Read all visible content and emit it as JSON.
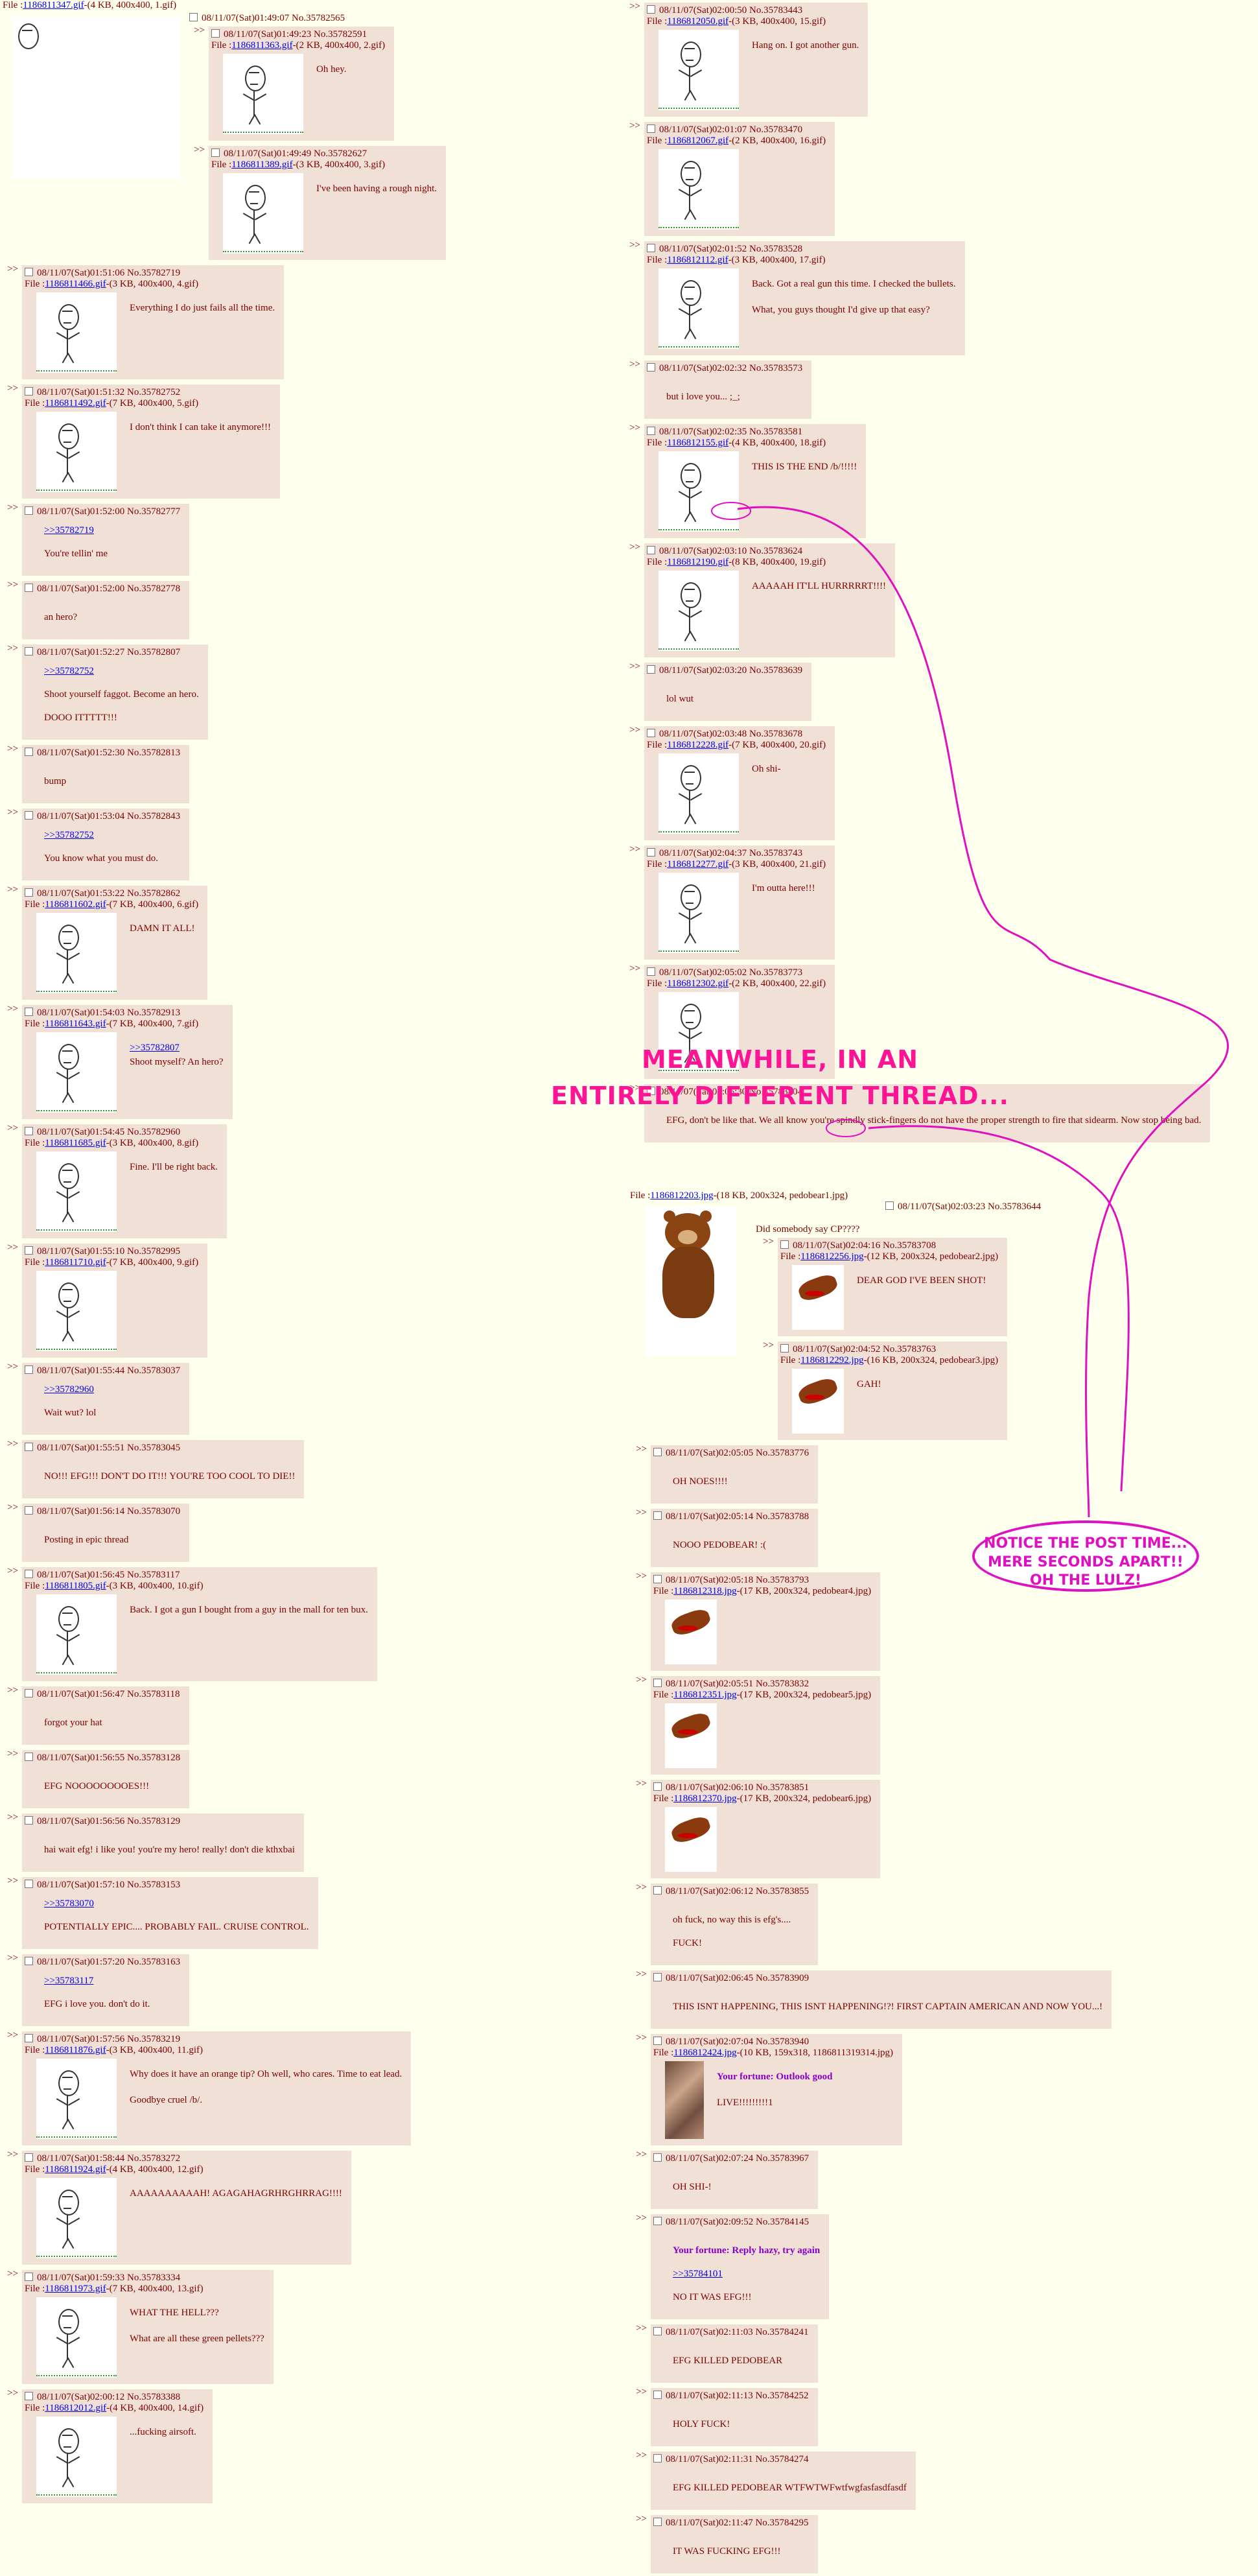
{
  "thread1": {
    "op": {
      "file_prefix": "File :",
      "file_link": "1186811347.gif",
      "file_meta": "-(4 KB, 400x400, 1.gif)"
    },
    "posts": [
      {
        "header": "08/11/07(Sat)01:49:07 No.35782565",
        "text": []
      },
      {
        "header": "08/11/07(Sat)01:49:23 No.35782591",
        "file": "1186811363.gif",
        "meta": "-(2 KB, 400x400, 2.gif)",
        "text": [
          "Oh hey."
        ]
      },
      {
        "header": "08/11/07(Sat)01:49:49 No.35782627",
        "file": "1186811389.gif",
        "meta": "-(3 KB, 400x400, 3.gif)",
        "text": [
          "I've been having a rough night."
        ]
      },
      {
        "header": "08/11/07(Sat)01:51:06 No.35782719",
        "file": "1186811466.gif",
        "meta": "-(3 KB, 400x400, 4.gif)",
        "text": [
          "Everything I do just fails all the time."
        ]
      },
      {
        "header": "08/11/07(Sat)01:51:32 No.35782752",
        "file": "1186811492.gif",
        "meta": "-(7 KB, 400x400, 5.gif)",
        "text": [
          "I don't think I can take it anymore!!!"
        ]
      },
      {
        "header": "08/11/07(Sat)01:52:00 No.35782777",
        "quote": ">>35782719",
        "text": [
          "You're tellin' me"
        ]
      },
      {
        "header": "08/11/07(Sat)01:52:00 No.35782778",
        "text": [
          "an hero?"
        ]
      },
      {
        "header": "08/11/07(Sat)01:52:27 No.35782807",
        "quote": ">>35782752",
        "text": [
          "Shoot yourself faggot. Become an hero.",
          "DOOO ITTTTT!!!"
        ]
      },
      {
        "header": "08/11/07(Sat)01:52:30 No.35782813",
        "text": [
          "bump"
        ]
      },
      {
        "header": "08/11/07(Sat)01:53:04 No.35782843",
        "quote": ">>35782752",
        "text": [
          "You know what you must do."
        ]
      },
      {
        "header": "08/11/07(Sat)01:53:22 No.35782862",
        "file": "1186811602.gif",
        "meta": "-(7 KB, 400x400, 6.gif)",
        "text": [
          "DAMN IT ALL!"
        ]
      },
      {
        "header": "08/11/07(Sat)01:54:03 No.35782913",
        "file": "1186811643.gif",
        "meta": "-(7 KB, 400x400, 7.gif)",
        "quote": ">>35782807",
        "text": [
          "Shoot myself? An hero?"
        ]
      },
      {
        "header": "08/11/07(Sat)01:54:45 No.35782960",
        "file": "1186811685.gif",
        "meta": "-(3 KB, 400x400, 8.gif)",
        "text": [
          "Fine. I'll be right back."
        ]
      },
      {
        "header": "08/11/07(Sat)01:55:10 No.35782995",
        "file": "1186811710.gif",
        "meta": "-(7 KB, 400x400, 9.gif)",
        "text": []
      },
      {
        "header": "08/11/07(Sat)01:55:44 No.35783037",
        "quote": ">>35782960",
        "text": [
          "Wait wut? lol"
        ]
      },
      {
        "header": "08/11/07(Sat)01:55:51 No.35783045",
        "text": [
          "NO!!! EFG!!! DON'T DO IT!!! YOU'RE TOO COOL TO DIE!!"
        ]
      },
      {
        "header": "08/11/07(Sat)01:56:14 No.35783070",
        "text": [
          "Posting in epic thread"
        ]
      },
      {
        "header": "08/11/07(Sat)01:56:45 No.35783117",
        "file": "1186811805.gif",
        "meta": "-(3 KB, 400x400, 10.gif)",
        "text": [
          "Back. I got a gun I bought from a guy in the mall for ten bux."
        ]
      },
      {
        "header": "08/11/07(Sat)01:56:47 No.35783118",
        "text": [
          "forgot your hat"
        ]
      },
      {
        "header": "08/11/07(Sat)01:56:55 No.35783128",
        "text": [
          "EFG NOOOOOOOOES!!!"
        ]
      },
      {
        "header": "08/11/07(Sat)01:56:56 No.35783129",
        "text": [
          "hai wait efg! i like you! you're my hero! really! don't die kthxbai"
        ]
      },
      {
        "header": "08/11/07(Sat)01:57:10 No.35783153",
        "quote": ">>35783070",
        "text": [
          "POTENTIALLY EPIC.... PROBABLY FAIL. CRUISE CONTROL."
        ]
      },
      {
        "header": "08/11/07(Sat)01:57:20 No.35783163",
        "quote": ">>35783117",
        "text": [
          "EFG i love you. don't do it."
        ]
      },
      {
        "header": "08/11/07(Sat)01:57:56 No.35783219",
        "file": "1186811876.gif",
        "meta": "-(3 KB, 400x400, 11.gif)",
        "text": [
          "Why does it have an orange tip? Oh well, who cares. Time to eat lead.",
          "Goodbye cruel /b/."
        ]
      },
      {
        "header": "08/11/07(Sat)01:58:44 No.35783272",
        "file": "1186811924.gif",
        "meta": "-(4 KB, 400x400, 12.gif)",
        "text": [
          "AAAAAAAAAAH! AGAGAHAGRHRGHRRAG!!!!"
        ]
      },
      {
        "header": "08/11/07(Sat)01:59:33 No.35783334",
        "file": "1186811973.gif",
        "meta": "-(7 KB, 400x400, 13.gif)",
        "text": [
          "WHAT THE HELL???",
          "What are all these green pellets???"
        ]
      },
      {
        "header": "08/11/07(Sat)02:00:12 No.35783388",
        "file": "1186812012.gif",
        "meta": "-(4 KB, 400x400, 14.gif)",
        "text": [
          "...fucking airsoft."
        ]
      }
    ],
    "right_posts": [
      {
        "header": "08/11/07(Sat)02:00:50 No.35783443",
        "file": "1186812050.gif",
        "meta": "-(3 KB, 400x400, 15.gif)",
        "text": [
          "Hang on. I got another gun."
        ]
      },
      {
        "header": "08/11/07(Sat)02:01:07 No.35783470",
        "file": "1186812067.gif",
        "meta": "-(2 KB, 400x400, 16.gif)",
        "text": []
      },
      {
        "header": "08/11/07(Sat)02:01:52 No.35783528",
        "file": "1186812112.gif",
        "meta": "-(3 KB, 400x400, 17.gif)",
        "text": [
          "Back. Got a real gun this time. I checked the bullets.",
          "What, you guys thought I'd give up that easy?"
        ]
      },
      {
        "header": "08/11/07(Sat)02:02:32 No.35783573",
        "text": [
          "but i love you... ;_;"
        ]
      },
      {
        "header": "08/11/07(Sat)02:02:35 No.35783581",
        "file": "1186812155.gif",
        "meta": "-(4 KB, 400x400, 18.gif)",
        "text": [
          "THIS IS THE END /b/!!!!!"
        ]
      },
      {
        "header": "08/11/07(Sat)02:03:10 No.35783624",
        "file": "1186812190.gif",
        "meta": "-(8 KB, 400x400, 19.gif)",
        "text": [
          "AAAAAH IT'LL HURRRRRT!!!!"
        ]
      },
      {
        "header": "08/11/07(Sat)02:03:20 No.35783639",
        "text": [
          "lol wut"
        ]
      },
      {
        "header": "08/11/07(Sat)02:03:48 No.35783678",
        "file": "1186812228.gif",
        "meta": "-(7 KB, 400x400, 20.gif)",
        "text": [
          "Oh shi-"
        ]
      },
      {
        "header": "08/11/07(Sat)02:04:37 No.35783743",
        "file": "1186812277.gif",
        "meta": "-(3 KB, 400x400, 21.gif)",
        "text": [
          "I'm outta here!!!"
        ]
      },
      {
        "header": "08/11/07(Sat)02:05:02 No.35783773",
        "file": "1186812302.gif",
        "meta": "-(2 KB, 400x400, 22.gif)",
        "text": []
      },
      {
        "header": "08/11/07(Sat)02:05:30 No.35783804",
        "text": [
          "EFG, don't be like that. We all know you're spindly stick-fingers do not have the proper strength to fire that sidearm. Now stop being bad."
        ]
      }
    ]
  },
  "annotation": {
    "title_line1": "MEANWHILE, IN AN",
    "title_line2": "ENTIRELY DIFFERENT THREAD...",
    "bubble_line1": "NOTICE THE POST TIME...",
    "bubble_line2": "MERE SECONDS APART!!",
    "bubble_line3": "OH THE LULZ!"
  },
  "thread2": {
    "op": {
      "file_prefix": "File :",
      "file_link": "1186812203.jpg",
      "file_meta": "-(18 KB, 200x324, pedobear1.jpg)"
    },
    "op_reply": {
      "header_date": "08/11/07(Sat)",
      "header_time": "02:03:23",
      "header_no": " No.35783644",
      "text": "Did somebody say CP????"
    },
    "posts": [
      {
        "header": "08/11/07(Sat)02:04:16 No.35783708",
        "file": "1186812256.jpg",
        "meta": "-(12 KB, 200x324, pedobear2.jpg)",
        "text": [
          "DEAR GOD I'VE BEEN SHOT!"
        ]
      },
      {
        "header": "08/11/07(Sat)02:04:52 No.35783763",
        "file": "1186812292.jpg",
        "meta": "-(16 KB, 200x324, pedobear3.jpg)",
        "text": [
          "GAH!"
        ]
      }
    ],
    "lower_posts": [
      {
        "header": "08/11/07(Sat)02:05:05 No.35783776",
        "text": [
          "OH NOES!!!!"
        ]
      },
      {
        "header": "08/11/07(Sat)02:05:14 No.35783788",
        "text": [
          "NOOO PEDOBEAR! :("
        ]
      },
      {
        "header": "08/11/07(Sat)02:05:18 No.35783793",
        "file": "1186812318.jpg",
        "meta": "-(17 KB, 200x324, pedobear4.jpg)",
        "text": []
      },
      {
        "header": "08/11/07(Sat)02:05:51 No.35783832",
        "file": "1186812351.jpg",
        "meta": "-(17 KB, 200x324, pedobear5.jpg)",
        "text": []
      },
      {
        "header": "08/11/07(Sat)02:06:10 No.35783851",
        "file": "1186812370.jpg",
        "meta": "-(17 KB, 200x324, pedobear6.jpg)",
        "text": []
      },
      {
        "header": "08/11/07(Sat)02:06:12 No.35783855",
        "text": [
          "oh fuck, no way this is efg's....",
          "FUCK!"
        ]
      },
      {
        "header": "08/11/07(Sat)02:06:45 No.35783909",
        "text": [
          "THIS ISNT HAPPENING, THIS ISNT HAPPENING!?! FIRST CAPTAIN AMERICAN AND NOW YOU...!"
        ]
      },
      {
        "header": "08/11/07(Sat)02:07:04 No.35783940",
        "file": "1186812424.jpg",
        "meta": "-(10 KB, 159x318, 1186811319314.jpg)",
        "fortune": "Your fortune: Outlook good",
        "text": [
          "LIVE!!!!!!!!!1"
        ]
      },
      {
        "header": "08/11/07(Sat)02:07:24 No.35783967",
        "text": [
          "OH SHI-!"
        ]
      },
      {
        "header": "08/11/07(Sat)02:09:52 No.35784145",
        "fortune": "Your fortune: Reply hazy, try again",
        "quote": ">>35784101",
        "text": [
          "NO IT WAS EFG!!!"
        ]
      },
      {
        "header": "08/11/07(Sat)02:11:03 No.35784241",
        "text": [
          "EFG KILLED PEDOBEAR"
        ]
      },
      {
        "header": "08/11/07(Sat)02:11:13 No.35784252",
        "text": [
          "HOLY FUCK!"
        ]
      },
      {
        "header": "08/11/07(Sat)02:11:31 No.35784274",
        "text": [
          "EFG KILLED PEDOBEAR WTFWTWFwtfwgfasfasdfasdf"
        ]
      },
      {
        "header": "08/11/07(Sat)02:11:47 No.35784295",
        "text": [
          "IT WAS FUCKING EFG!!!"
        ]
      }
    ]
  },
  "ui": {
    "arrow": ">>",
    "file_prefix": "File :"
  },
  "colors": {
    "background": "#FFFFEE",
    "reply_bg": "#F0E0D6",
    "text": "#800000",
    "link": "#0000EE",
    "annotation": "#FF1493",
    "fortune": "#8B00C8"
  }
}
